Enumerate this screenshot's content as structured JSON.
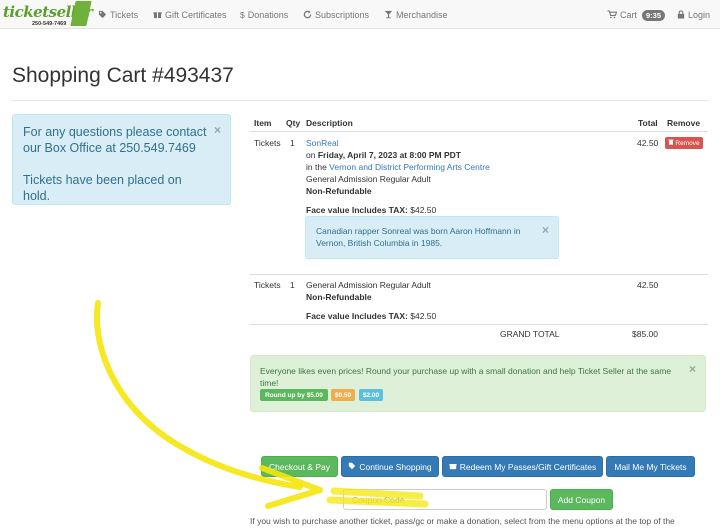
{
  "nav": {
    "logo_text": "ticketseller",
    "logo_phone": "250-549-7469",
    "items": [
      {
        "label": "Tickets",
        "icon": "tag-icon"
      },
      {
        "label": "Gift Certificates",
        "icon": "gift-icon"
      },
      {
        "label": "Donations",
        "icon": "dollar-icon"
      },
      {
        "label": "Subscriptions",
        "icon": "sync-icon"
      },
      {
        "label": "Merchandise",
        "icon": "glass-icon"
      }
    ],
    "cart_label": "Cart",
    "cart_badge": "9:35",
    "login_label": "Login"
  },
  "page": {
    "title": "Shopping Cart #493437"
  },
  "info_alert": {
    "line1": "For any questions please contact our Box Office at 250.549.7469",
    "line2": "Tickets have been placed on hold.",
    "close": "×"
  },
  "table": {
    "headers": {
      "item": "Item",
      "qty": "Qty",
      "description": "Description",
      "total": "Total",
      "remove": "Remove"
    },
    "rows": [
      {
        "item": "Tickets",
        "qty": "1",
        "event_name": "SonReal",
        "date_prefix": "on",
        "date": "Friday, April 7, 2023 at 8:00 PM PDT",
        "venue_prefix": "in the",
        "venue": "Vernon and District Performing Arts Centre",
        "admission": "General Admission Regular Adult",
        "refund": "Non-Refundable",
        "face_label": "Face value Includes TAX:",
        "face_value": "$42.50",
        "note": "Canadian rapper Sonreal was born Aaron Hoffmann in Vernon, British Columbia in 1985.",
        "total": "42.50",
        "remove_label": "Remove"
      },
      {
        "item": "Tickets",
        "qty": "1",
        "admission": "General Admission Regular Adult",
        "refund": "Non-Refundable",
        "face_label": "Face value Includes TAX:",
        "face_value": "$42.50",
        "total": "42.50"
      }
    ],
    "grand_total_label": "GRAND TOTAL",
    "grand_total": "$85.00"
  },
  "round_up": {
    "message": "Everyone likes even prices!   Round your purchase up with a small donation and help Ticket Seller at the same time!",
    "close": "×",
    "options": [
      "Round up by $5.00",
      "$0.50",
      "$2.00"
    ]
  },
  "actions": {
    "checkout": "Checkout & Pay",
    "continue": "Continue Shopping",
    "redeem": "Redeem My Passes/Gift Certificates",
    "mail": "Mail Me My Tickets"
  },
  "coupon": {
    "placeholder": "Coupon Code",
    "button": "Add Coupon"
  },
  "footer": {
    "text": "If you wish to purchase another ticket, pass/gc or make a donation, select from the menu options at the top of the"
  },
  "colors": {
    "highlight": "#f5e60a",
    "brand_green": "#5aa02c",
    "danger": "#d9534f",
    "primary": "#337ab7",
    "success": "#5cb85c",
    "warning": "#f0ad4e",
    "info": "#5bc0de"
  }
}
